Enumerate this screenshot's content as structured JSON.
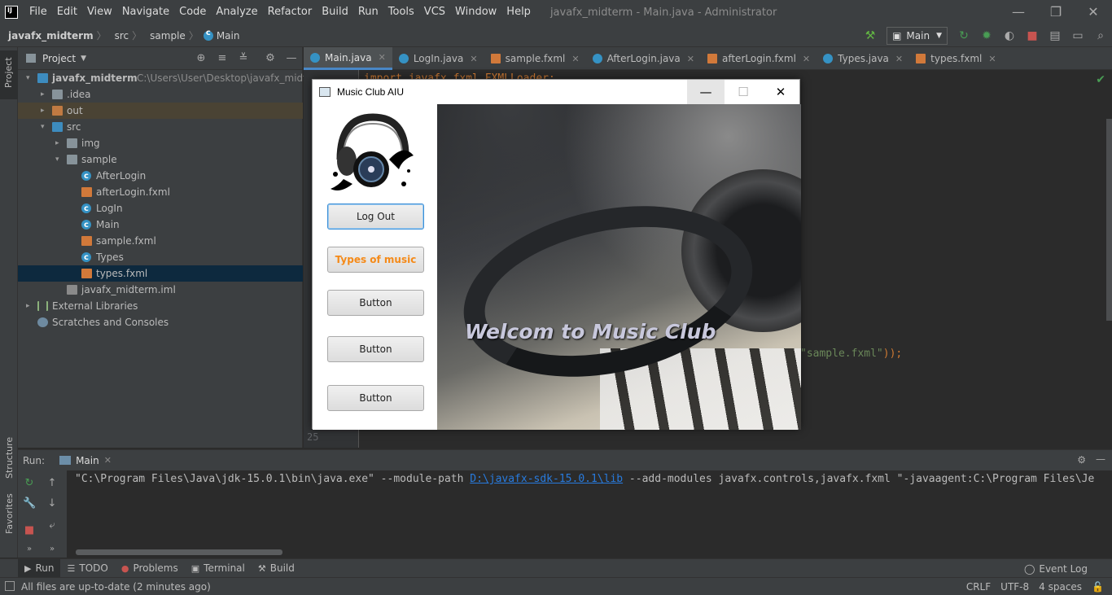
{
  "menubar": {
    "items": [
      "File",
      "Edit",
      "View",
      "Navigate",
      "Code",
      "Analyze",
      "Refactor",
      "Build",
      "Run",
      "Tools",
      "VCS",
      "Window",
      "Help"
    ],
    "window_title": "javafx_midterm - Main.java - Administrator"
  },
  "navbar": {
    "crumbs": [
      "javafx_midterm",
      "src",
      "sample",
      "Main"
    ],
    "run_config": "Main"
  },
  "project": {
    "title": "Project",
    "tree": [
      {
        "label": "javafx_midterm",
        "path": "C:\\Users\\User\\Desktop\\javafx_midterm",
        "icon": "folder-blue",
        "level": 0,
        "arrow": "▾"
      },
      {
        "label": ".idea",
        "icon": "folder",
        "level": 1,
        "arrow": "▸"
      },
      {
        "label": "out",
        "icon": "folder-orange",
        "level": 1,
        "arrow": "▸"
      },
      {
        "label": "src",
        "icon": "folder-blue",
        "level": 1,
        "arrow": "▾"
      },
      {
        "label": "img",
        "icon": "folder",
        "level": 2,
        "arrow": "▸"
      },
      {
        "label": "sample",
        "icon": "folder",
        "level": 2,
        "arrow": "▾"
      },
      {
        "label": "AfterLogin",
        "icon": "class",
        "level": 3
      },
      {
        "label": "afterLogin.fxml",
        "icon": "fxml",
        "level": 3
      },
      {
        "label": "LogIn",
        "icon": "class",
        "level": 3
      },
      {
        "label": "Main",
        "icon": "class",
        "level": 3
      },
      {
        "label": "sample.fxml",
        "icon": "fxml",
        "level": 3
      },
      {
        "label": "Types",
        "icon": "class",
        "level": 3
      },
      {
        "label": "types.fxml",
        "icon": "fxml",
        "level": 3
      },
      {
        "label": "javafx_midterm.iml",
        "icon": "iml",
        "level": 2
      },
      {
        "label": "External Libraries",
        "icon": "lib",
        "level": 0,
        "arrow": "▸"
      },
      {
        "label": "Scratches and Consoles",
        "icon": "scratch",
        "level": 0
      }
    ]
  },
  "tabs": [
    {
      "label": "Main.java",
      "icon": "class",
      "active": true
    },
    {
      "label": "LogIn.java",
      "icon": "class"
    },
    {
      "label": "sample.fxml",
      "icon": "fxml"
    },
    {
      "label": "AfterLogin.java",
      "icon": "class"
    },
    {
      "label": "afterLogin.fxml",
      "icon": "fxml"
    },
    {
      "label": "Types.java",
      "icon": "class"
    },
    {
      "label": "types.fxml",
      "icon": "fxml"
    }
  ],
  "editor": {
    "top_code": "import javafx.fxml.FXMLLoader;",
    "visible_code": "\"sample.fxml\"",
    "visible_code_tail": "));",
    "line_number": "25"
  },
  "music_window": {
    "title": "Music Club AIU",
    "buttons": [
      "Log Out",
      "Types of music",
      "Button",
      "Button",
      "Button"
    ],
    "welcome": "Welcom to Music Club"
  },
  "left_stripe": {
    "project": "Project",
    "structure": "Structure",
    "favorites": "Favorites"
  },
  "run_panel": {
    "label": "Run:",
    "tab": "Main",
    "console_pre": "\"C:\\Program Files\\Java\\jdk-15.0.1\\bin\\java.exe\" --module-path ",
    "console_link": "D:\\javafx-sdk-15.0.1\\lib",
    "console_post": " --add-modules javafx.controls,javafx.fxml \"-javaagent:C:\\Program Files\\Je"
  },
  "bottom_tools": {
    "items": [
      "Run",
      "TODO",
      "Problems",
      "Terminal",
      "Build"
    ],
    "event_log": "Event Log"
  },
  "statusbar": {
    "text": "All files are up-to-date (2 minutes ago)",
    "line_sep": "CRLF",
    "encoding": "UTF-8",
    "indent": "4 spaces"
  }
}
